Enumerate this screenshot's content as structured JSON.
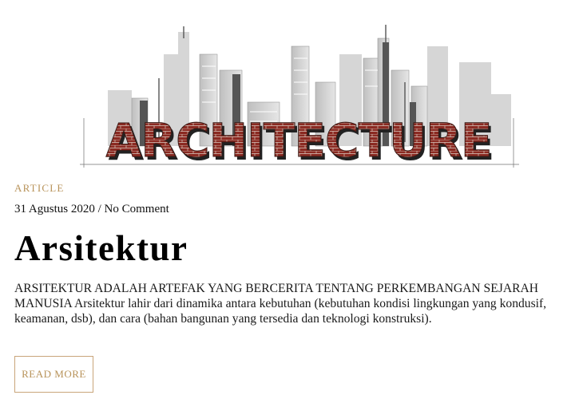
{
  "post": {
    "image_alt": "Architecture",
    "logo_text": "ARCHITECTURE",
    "category": "ARTICLE",
    "date": "31 Agustus 2020",
    "separator": " / ",
    "comments": "No Comment",
    "title": "Arsitektur",
    "excerpt": "ARSITEKTUR ADALAH ARTEFAK YANG BERCERITA TENTANG PERKEMBANGAN SEJARAH MANUSIA Arsitektur lahir dari dinamika antara kebutuhan (kebutuhan kondisi lingkungan yang kondusif, keamanan, dsb), dan cara (bahan bangunan yang tersedia dan teknologi konstruksi).",
    "read_more": "READ MORE"
  },
  "colors": {
    "accent": "#b8935a",
    "brick": "#8b2a22"
  }
}
